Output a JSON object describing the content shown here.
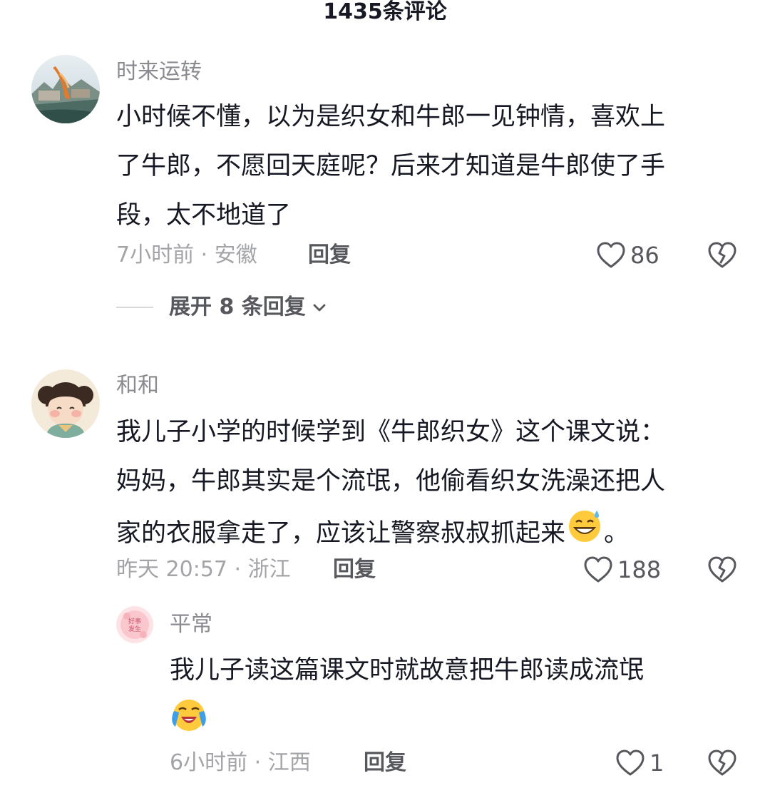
{
  "header": {
    "title": "1435条评论"
  },
  "comments": [
    {
      "username": "时来运转",
      "lines": [
        "小时候不懂，以为是织女和牛郎一见钟情，喜欢上",
        "了牛郎，不愿回天庭呢？后来才知道是牛郎使了手",
        "段，太不地道了"
      ],
      "meta": "7小时前 · 安徽",
      "reply_label": "回复",
      "likes": "86",
      "expand_label": "展开 8 条回复"
    },
    {
      "username": "和和",
      "lines": [
        "我儿子小学的时候学到《牛郎织女》这个课文说：",
        "妈妈，牛郎其实是个流氓，他偷看织女洗澡还把人",
        "家的衣服拿走了，应该让警察叔叔抓起来"
      ],
      "line3_tail": "。",
      "meta": "昨天 20:57 · 浙江",
      "reply_label": "回复",
      "likes": "188"
    }
  ],
  "replies": [
    {
      "username": "平常",
      "avatar_text": "好事发生",
      "lines": [
        "我儿子读这篇课文时就故意把牛郎读成流氓"
      ],
      "meta": "6小时前 · 江西",
      "reply_label": "回复",
      "likes": "1"
    }
  ],
  "icons": {
    "like": "heart-outline-icon",
    "dislike": "broken-heart-icon",
    "expand": "chevron-down-icon"
  },
  "colors": {
    "text_primary": "#161823",
    "text_secondary": "#8a8b91",
    "text_meta": "#a3a4a8",
    "text_action": "#57585e"
  }
}
